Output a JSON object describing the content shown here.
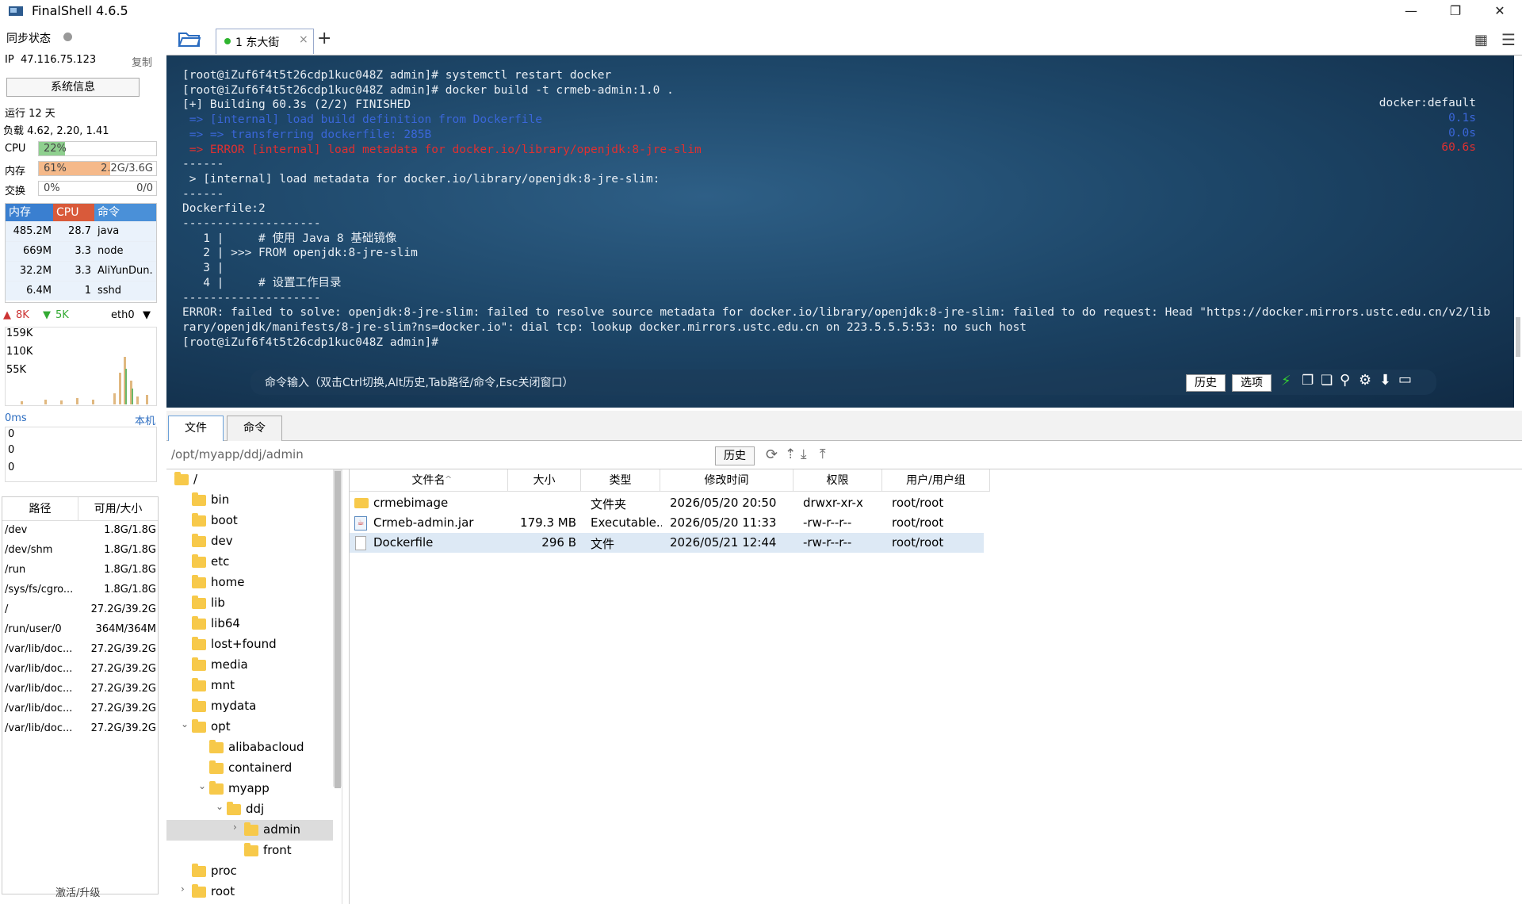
{
  "window": {
    "title": "FinalShell 4.6.5"
  },
  "left": {
    "sync_label": "同步状态",
    "ip_label": "IP",
    "ip": "47.116.75.123",
    "copy": "复制",
    "sysinfo_button": "系统信息",
    "uptime": "运行 12 天",
    "load": "负载 4.62, 2.20, 1.41",
    "cpu": {
      "label": "CPU",
      "percent_text": "22%",
      "value": 22
    },
    "mem": {
      "label": "内存",
      "percent_text": "61%",
      "value": 61,
      "detail": "2.2G/3.6G"
    },
    "swap": {
      "label": "交换",
      "percent_text": "0%",
      "value": 0,
      "detail": "0/0"
    },
    "proc_headers": [
      "内存",
      "CPU",
      "命令"
    ],
    "procs": [
      {
        "mem": "485.2M",
        "cpu": "28.7",
        "cmd": "java"
      },
      {
        "mem": "669M",
        "cpu": "3.3",
        "cmd": "node"
      },
      {
        "mem": "32.2M",
        "cpu": "3.3",
        "cmd": "AliYunDun."
      },
      {
        "mem": "6.4M",
        "cpu": "1",
        "cmd": "sshd"
      }
    ],
    "net": {
      "up": "8K",
      "down": "5K",
      "iface": "eth0",
      "y_labels": [
        "159K",
        "110K",
        "55K"
      ]
    },
    "latency": {
      "label": "0ms",
      "host": "本机",
      "y_labels": [
        "0",
        "0",
        "0"
      ]
    },
    "fs_headers": [
      "路径",
      "可用/大小"
    ],
    "fs": [
      {
        "path": "/dev",
        "size": "1.8G/1.8G"
      },
      {
        "path": "/dev/shm",
        "size": "1.8G/1.8G"
      },
      {
        "path": "/run",
        "size": "1.8G/1.8G"
      },
      {
        "path": "/sys/fs/cgro...",
        "size": "1.8G/1.8G"
      },
      {
        "path": "/",
        "size": "27.2G/39.2G"
      },
      {
        "path": "/run/user/0",
        "size": "364M/364M"
      },
      {
        "path": "/var/lib/doc...",
        "size": "27.2G/39.2G"
      },
      {
        "path": "/var/lib/doc...",
        "size": "27.2G/39.2G"
      },
      {
        "path": "/var/lib/doc...",
        "size": "27.2G/39.2G"
      },
      {
        "path": "/var/lib/doc...",
        "size": "27.2G/39.2G"
      },
      {
        "path": "/var/lib/doc...",
        "size": "27.2G/39.2G"
      }
    ],
    "activate": "激活/升级"
  },
  "tabs": [
    {
      "label": "1 东大街"
    }
  ],
  "terminal": {
    "lines": [
      "[root@iZuf6f4t5t26cdp1kuc048Z admin]# systemctl restart docker",
      "[root@iZuf6f4t5t26cdp1kuc048Z admin]# docker build -t crmeb-admin:1.0 .",
      "[+] Building 60.3s (2/2) FINISHED"
    ],
    "blue1": " => [internal] load build definition from Dockerfile",
    "blue2": " => => transferring dockerfile: 285B",
    "red1": " => ERROR [internal] load metadata for docker.io/library/openjdk:8-jre-slim",
    "lines2": [
      "------",
      " > [internal] load metadata for docker.io/library/openjdk:8-jre-slim:",
      "------",
      "Dockerfile:2",
      "--------------------",
      "   1 |     # 使用 Java 8 基础镜像",
      "   2 | >>> FROM openjdk:8-jre-slim",
      "   3 |",
      "   4 |     # 设置工作目录",
      "--------------------",
      "ERROR: failed to solve: openjdk:8-jre-slim: failed to resolve source metadata for docker.io/library/openjdk:8-jre-slim: failed to do request: Head \"https://docker.mirrors.ustc.edu.cn/v2/lib",
      "rary/openjdk/manifests/8-jre-slim?ns=docker.io\": dial tcp: lookup docker.mirrors.ustc.edu.cn on 223.5.5.5:53: no such host",
      "[root@iZuf6f4t5t26cdp1kuc048Z admin]#"
    ],
    "right_default": "docker:default",
    "right_t1": "0.1s",
    "right_t2": "0.0s",
    "right_t3": "60.6s",
    "cmd_placeholder": "命令输入（双击Ctrl切换,Alt历史,Tab路径/命令,Esc关闭窗口）",
    "history_btn": "历史",
    "options_btn": "选项"
  },
  "bottom_tabs": [
    "文件",
    "命令"
  ],
  "path": {
    "value": "/opt/myapp/ddj/admin",
    "history": "历史"
  },
  "tree": [
    {
      "label": "/",
      "level": 0,
      "arrow": "",
      "expanded": true
    },
    {
      "label": "bin",
      "level": 1,
      "arrow": ""
    },
    {
      "label": "boot",
      "level": 1,
      "arrow": ""
    },
    {
      "label": "dev",
      "level": 1,
      "arrow": ""
    },
    {
      "label": "etc",
      "level": 1,
      "arrow": ""
    },
    {
      "label": "home",
      "level": 1,
      "arrow": ""
    },
    {
      "label": "lib",
      "level": 1,
      "arrow": ""
    },
    {
      "label": "lib64",
      "level": 1,
      "arrow": ""
    },
    {
      "label": "lost+found",
      "level": 1,
      "arrow": ""
    },
    {
      "label": "media",
      "level": 1,
      "arrow": ""
    },
    {
      "label": "mnt",
      "level": 1,
      "arrow": ""
    },
    {
      "label": "mydata",
      "level": 1,
      "arrow": ""
    },
    {
      "label": "opt",
      "level": 1,
      "arrow": "v"
    },
    {
      "label": "alibabacloud",
      "level": 2,
      "arrow": ""
    },
    {
      "label": "containerd",
      "level": 2,
      "arrow": ""
    },
    {
      "label": "myapp",
      "level": 2,
      "arrow": "v"
    },
    {
      "label": "ddj",
      "level": 3,
      "arrow": "v"
    },
    {
      "label": "admin",
      "level": 4,
      "arrow": ">",
      "selected": true
    },
    {
      "label": "front",
      "level": 4,
      "arrow": ""
    },
    {
      "label": "proc",
      "level": 1,
      "arrow": ""
    },
    {
      "label": "root",
      "level": 1,
      "arrow": ">"
    }
  ],
  "file_headers": [
    "文件名",
    "大小",
    "类型",
    "修改时间",
    "权限",
    "用户/用户组"
  ],
  "files": [
    {
      "name": "crmebimage",
      "size": "",
      "type": "文件夹",
      "mtime": "2026/05/20 20:50",
      "perm": "drwxr-xr-x",
      "owner": "root/root",
      "icon": "folder"
    },
    {
      "name": "Crmeb-admin.jar",
      "size": "179.3 MB",
      "type": "Executable...",
      "mtime": "2026/05/20 11:33",
      "perm": "-rw-r--r--",
      "owner": "root/root",
      "icon": "jar"
    },
    {
      "name": "Dockerfile",
      "size": "296 B",
      "type": "文件",
      "mtime": "2026/05/21 12:44",
      "perm": "-rw-r--r--",
      "owner": "root/root",
      "icon": "file",
      "selected": true
    }
  ],
  "colors": {
    "cpu_fill": "#8fd08f",
    "mem_fill": "#f5b98a",
    "proc_hdr_mem": "#3a7fd0",
    "proc_hdr_cpu": "#d95a3a",
    "proc_hdr_cmd": "#4a90d8",
    "selected_row": "#dde9f5"
  }
}
